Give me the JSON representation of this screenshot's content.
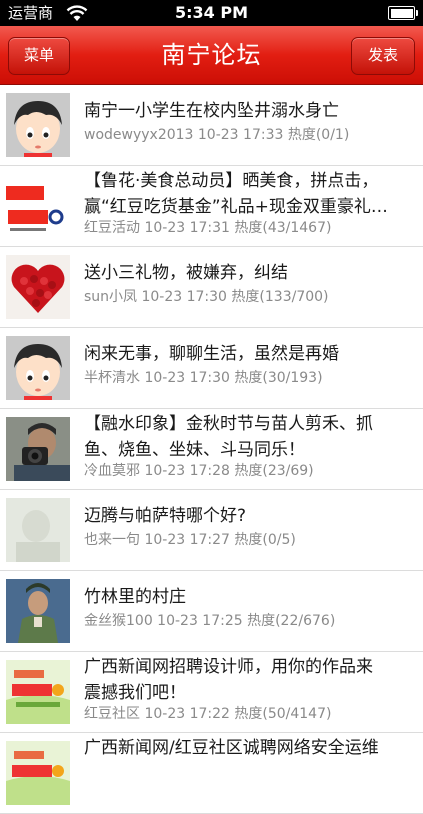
{
  "status_bar": {
    "carrier": "运营商",
    "time": "5:34 PM"
  },
  "nav": {
    "title": "南宁论坛",
    "left_button": "菜单",
    "right_button": "发表"
  },
  "posts": [
    {
      "title": "南宁一小学生在校内坠井溺水身亡",
      "title_line2": "",
      "meta": "wodewyyx2013 10-23 17:33 热度(0/1)",
      "avatar": "cartoon-boy-avatar"
    },
    {
      "title": "【鲁花·美食总动员】晒美食，拼点击，",
      "title_line2": "赢“红豆吃货基金”礼品+现金双重豪礼…",
      "meta": "红豆活动 10-23 17:31 热度(43/1467)",
      "avatar": "event-logo-avatar"
    },
    {
      "title": "送小三礼物，被嫌弃，纠结",
      "title_line2": "",
      "meta": "sun小凤 10-23 17:30 热度(133/700)",
      "avatar": "heart-roses-avatar"
    },
    {
      "title": "闲来无事，聊聊生活，虽然是再婚",
      "title_line2": "",
      "meta": "半杯清水 10-23 17:30 热度(30/193)",
      "avatar": "cartoon-boy-avatar"
    },
    {
      "title": "【融水印象】金秋时节与苗人剪禾、抓",
      "title_line2": "鱼、烧鱼、坐妹、斗马同乐！",
      "meta": "冷血莫邪 10-23 17:28 热度(23/69)",
      "avatar": "photographer-avatar"
    },
    {
      "title": "迈腾与帕萨特哪个好?",
      "title_line2": "",
      "meta": "也来一句 10-23 17:27 热度(0/5)",
      "avatar": "faded-photo-avatar"
    },
    {
      "title": "竹林里的村庄",
      "title_line2": "",
      "meta": "金丝猴100 10-23 17:25 热度(22/676)",
      "avatar": "soldier-avatar"
    },
    {
      "title": "广西新闻网招聘设计师，用你的作品来",
      "title_line2": "震撼我们吧！",
      "meta": "红豆社区 10-23 17:22 热度(50/4147)",
      "avatar": "hongdou-logo-avatar"
    },
    {
      "title": "广西新闻网/红豆社区诚聘网络安全运维",
      "title_line2": "",
      "meta": "",
      "avatar": "hongdou-logo-avatar"
    }
  ]
}
